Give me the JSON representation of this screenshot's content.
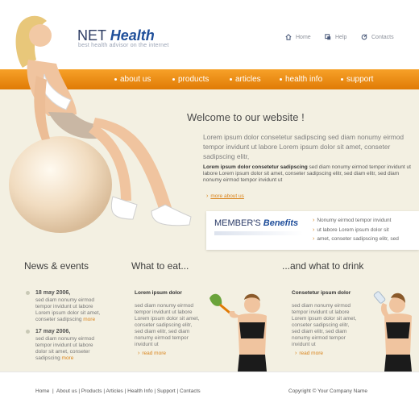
{
  "header": {
    "logo_net": "NET",
    "logo_health": "Health",
    "tagline": "best health advisor on the internet",
    "links": [
      {
        "label": "Home",
        "icon": "home-icon"
      },
      {
        "label": "Help",
        "icon": "help-icon"
      },
      {
        "label": "Contacts",
        "icon": "contacts-icon"
      }
    ]
  },
  "nav": {
    "items": [
      "about us",
      "products",
      "articles",
      "health info",
      "support"
    ],
    "accent": "#f2921a"
  },
  "welcome": {
    "title": "Welcome to our website !",
    "intro": "Lorem ipsum dolor consetetur sadipscing sed diam nonumy eirmod tempor invidunt ut labore Lorem ipsum dolor sit amet, conseter sadipscing elitr,",
    "sub_bold": "Lorem ipsum dolor consetetur sadipscing",
    "sub_text": " sed diam nonumy eirmod tempor invidunt ut labore Lorem ipsum dolor sit amet, conseter sadipscing elitr, sed diam  elitr, sed diam nonumy eirmod tempor invidunt ut",
    "more": "more about us"
  },
  "members": {
    "title_a": "MEMBER'S",
    "title_b": "Benefits",
    "items": [
      "Nonumy eirmod tempor invidunt",
      "ut labore Lorem ipsum dolor sit",
      "amet, conseter sadipscing elitr, sed"
    ]
  },
  "news": {
    "title": "News & events",
    "items": [
      {
        "date": "18 may 2006,",
        "text": "sed diam nonumy eirmod tempor invidunt ut labore Lorem ipsum dolor sit amet, conseter sadipscing",
        "more": "more"
      },
      {
        "date": "17 may 2006,",
        "text": "sed diam nonumy eirmod tempor invidunt ut labore dolor sit amet, conseter sadipscing",
        "more": "more"
      }
    ]
  },
  "eat": {
    "title": "What to eat...",
    "head": "Lorem ipsum dolor",
    "text": "sed diam nonumy eirmod tempor invidunt ut labore Lorem ipsum dolor sit amet, conseter sadipscing elitr, sed diam  elitr, sed diam nonumy eirmod tempor invidunt ut",
    "more": "read more"
  },
  "drink": {
    "title": "...and what to drink",
    "head": "Consetetur ipsum dolor",
    "text": "sed diam nonumy eirmod tempor invidunt ut labore Lorem ipsum dolor sit amet, conseter sadipscing elitr, sed diam  elitr, sed diam nonumy eirmod tempor invidunt ut",
    "more": "read more"
  },
  "footer": {
    "links": [
      "Home",
      "About us",
      "Products",
      "Articles",
      "Health Info",
      "Support",
      "Contacts"
    ],
    "copyright": "Copyright © Your Company Name"
  }
}
